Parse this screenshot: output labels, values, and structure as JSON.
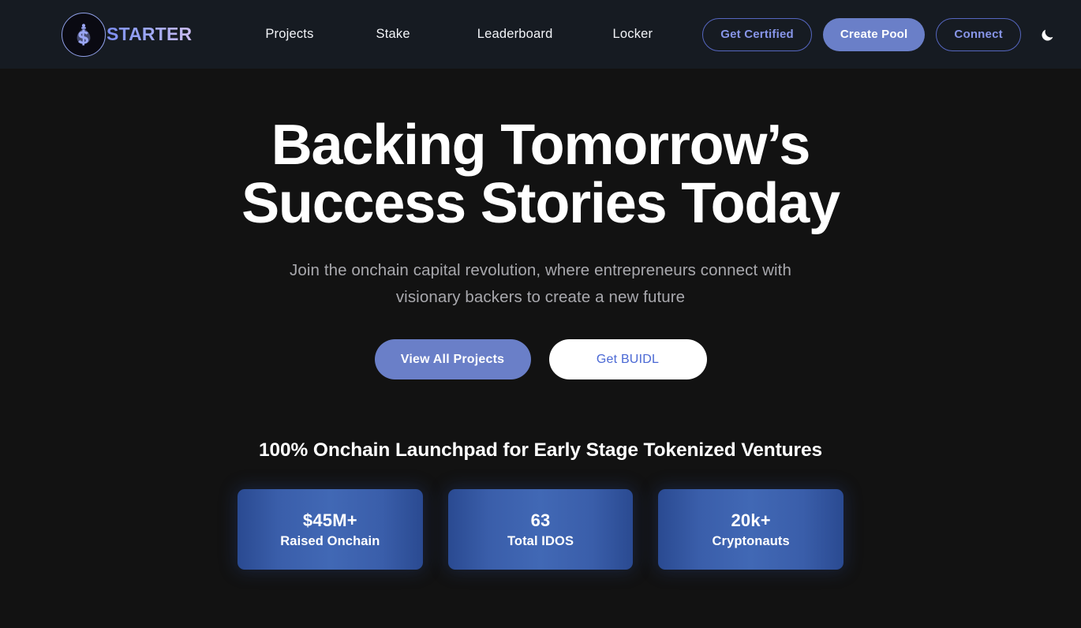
{
  "header": {
    "brand": {
      "name": "STARTER",
      "icon": "dollar-coin-logo-icon"
    },
    "nav": [
      {
        "label": "Projects"
      },
      {
        "label": "Stake"
      },
      {
        "label": "Leaderboard"
      },
      {
        "label": "Locker"
      }
    ],
    "actions": {
      "get_certified_label": "Get Certified",
      "create_pool_label": "Create Pool",
      "connect_label": "Connect",
      "theme_toggle_icon": "moon-icon"
    }
  },
  "hero": {
    "title_line1": "Backing Tomorrow’s",
    "title_line2": "Success Stories Today",
    "subtitle_line1": "Join the onchain capital revolution, where entrepreneurs connect with",
    "subtitle_line2": "visionary backers to create a new future",
    "primary_cta_label": "View All Projects",
    "secondary_cta_label": "Get BUIDL"
  },
  "stats": {
    "heading": "100% Onchain Launchpad for Early Stage Tokenized Ventures",
    "cards": [
      {
        "value": "$45M+",
        "label": "Raised Onchain"
      },
      {
        "value": "63",
        "label": "Total IDOS"
      },
      {
        "value": "20k+",
        "label": "Cryptonauts"
      }
    ]
  },
  "colors": {
    "page_background": "#121212",
    "header_background": "#161b22",
    "accent_periwinkle": "#6a7fc8",
    "accent_border": "#5566bf",
    "link_blue": "#4a68d4",
    "card_blue": "#3a5eaa",
    "muted_text": "#a8a8ad"
  }
}
